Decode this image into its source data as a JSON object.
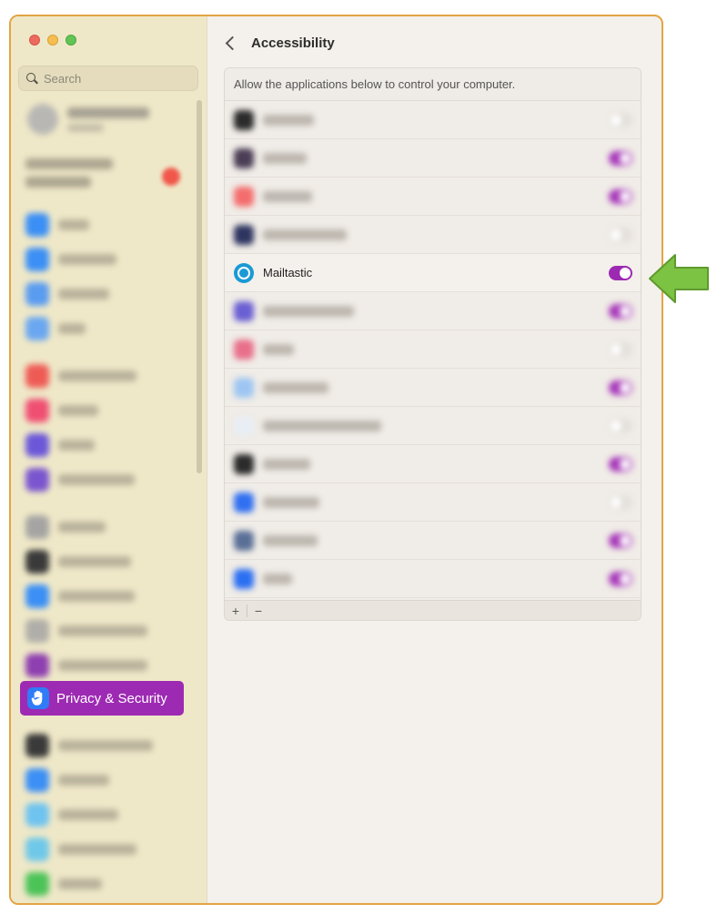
{
  "window": {
    "accent": "#9d2ab3"
  },
  "sidebar": {
    "search_placeholder": "Search",
    "selected_item": {
      "label": "Privacy & Security",
      "icon": "hand-raised-icon"
    }
  },
  "header": {
    "title": "Accessibility",
    "back_icon": "chevron-left-icon"
  },
  "panel": {
    "description": "Allow the applications below to control your computer.",
    "highlighted_app": {
      "name": "Mailtastic",
      "enabled": true,
      "icon": "mailtastic-logo-icon"
    },
    "footer": {
      "add_label": "+",
      "remove_label": "−"
    }
  },
  "annotation": {
    "color": "#7cc243",
    "icon": "left-arrow-icon"
  }
}
